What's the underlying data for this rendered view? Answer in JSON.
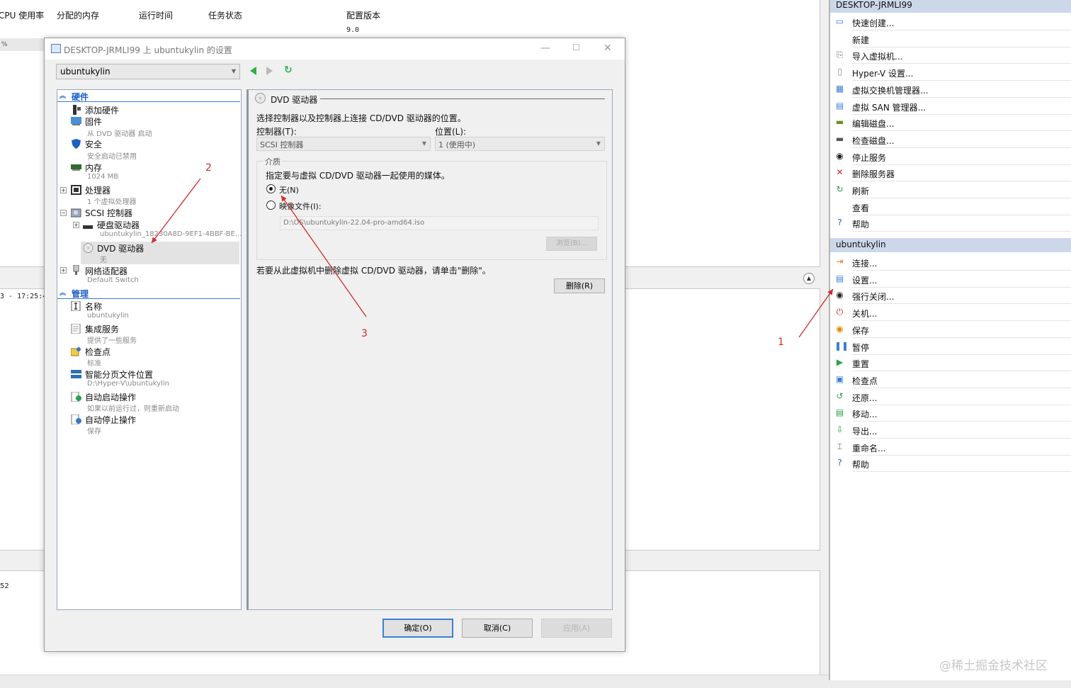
{
  "background": {
    "columns": [
      "CPU 使用率",
      "分配的内存",
      "运行时间",
      "任务状态",
      "配置版本"
    ],
    "config_version_value": "9.0",
    "row_cpu_fragment": "%",
    "time_fragment": "3 - 17:25:4",
    "bottom_fragment": "52"
  },
  "actions": {
    "host_header": "DESKTOP-JRMLI99",
    "host_items": [
      {
        "label": "快速创建...",
        "icon": "quick-create-icon"
      },
      {
        "label": "新建",
        "icon": ""
      },
      {
        "label": "导入虚拟机...",
        "icon": "import-vm-icon"
      },
      {
        "label": "Hyper-V 设置...",
        "icon": "hyperv-settings-icon"
      },
      {
        "label": "虚拟交换机管理器...",
        "icon": "virtual-switch-icon"
      },
      {
        "label": "虚拟 SAN 管理器...",
        "icon": "virtual-san-icon"
      },
      {
        "label": "编辑磁盘...",
        "icon": "edit-disk-icon"
      },
      {
        "label": "检查磁盘...",
        "icon": "inspect-disk-icon"
      },
      {
        "label": "停止服务",
        "icon": "stop-service-icon"
      },
      {
        "label": "删除服务器",
        "icon": "remove-server-icon"
      },
      {
        "label": "刷新",
        "icon": "refresh-icon"
      },
      {
        "label": "查看",
        "icon": ""
      },
      {
        "label": "帮助",
        "icon": "help-icon"
      }
    ],
    "vm_header": "ubuntukylin",
    "vm_items": [
      {
        "label": "连接...",
        "icon": "connect-icon"
      },
      {
        "label": "设置...",
        "icon": "settings-icon"
      },
      {
        "label": "强行关闭...",
        "icon": "turn-off-icon"
      },
      {
        "label": "关机...",
        "icon": "shutdown-icon"
      },
      {
        "label": "保存",
        "icon": "save-icon"
      },
      {
        "label": "暂停",
        "icon": "pause-icon"
      },
      {
        "label": "重置",
        "icon": "reset-icon"
      },
      {
        "label": "检查点",
        "icon": "checkpoint-icon"
      },
      {
        "label": "还原...",
        "icon": "revert-icon"
      },
      {
        "label": "移动...",
        "icon": "move-icon"
      },
      {
        "label": "导出...",
        "icon": "export-icon"
      },
      {
        "label": "重命名...",
        "icon": "rename-icon"
      },
      {
        "label": "帮助",
        "icon": "help-icon"
      }
    ]
  },
  "dialog": {
    "title": "DESKTOP-JRMLI99 上 ubuntukylin 的设置",
    "vm_select": "ubuntukylin",
    "tree": {
      "hardware_section": "硬件",
      "add_hardware": "添加硬件",
      "firmware": "固件",
      "firmware_sub": "从 DVD 驱动器 启动",
      "security": "安全",
      "security_sub": "安全启动已禁用",
      "memory": "内存",
      "memory_sub": "1024 MB",
      "processor": "处理器",
      "processor_sub": "1 个虚拟处理器",
      "scsi": "SCSI 控制器",
      "hard_drive": "硬盘驱动器",
      "hard_drive_sub": "ubuntukylin_18230A8D-9EF1-4BBF-BE...",
      "dvd": "DVD 驱动器",
      "dvd_sub": "无",
      "network": "网络适配器",
      "network_sub": "Default Switch",
      "management_section": "管理",
      "name": "名称",
      "name_sub": "ubuntukylin",
      "integration": "集成服务",
      "integration_sub": "提供了一些服务",
      "checkpoints": "检查点",
      "checkpoints_sub": "标准",
      "paging": "智能分页文件位置",
      "paging_sub": "D:\\Hyper-V\\ubuntukylin",
      "auto_start": "自动启动操作",
      "auto_start_sub": "如果以前运行过，则重新启动",
      "auto_stop": "自动停止操作",
      "auto_stop_sub": "保存"
    },
    "detail": {
      "heading": "DVD 驱动器",
      "description": "选择控制器以及控制器上连接 CD/DVD 驱动器的位置。",
      "controller_label": "控制器(T):",
      "controller_value": "SCSI 控制器",
      "location_label": "位置(L):",
      "location_value": "1 (使用中)",
      "media_group": "介质",
      "media_desc": "指定要与虚拟 CD/DVD 驱动器一起使用的媒体。",
      "none_option": "无(N)",
      "image_option": "映像文件(I):",
      "image_path": "D:\\OS\\ubuntukylin-22.04-pro-amd64.iso",
      "browse": "浏览(B)...",
      "remove_desc": "若要从此虚拟机中删除虚拟 CD/DVD 驱动器，请单击\"删除\"。",
      "remove": "删除(R)"
    },
    "buttons": {
      "ok": "确定(O)",
      "cancel": "取消(C)",
      "apply": "应用(A)"
    }
  },
  "annotations": {
    "one": "1",
    "two": "2",
    "three": "3"
  },
  "watermark": "@稀土掘金技术社区",
  "colors": {
    "accent": "#3a7bd5",
    "annotation": "#d42a2a",
    "action_header": "#ccd8ea"
  }
}
